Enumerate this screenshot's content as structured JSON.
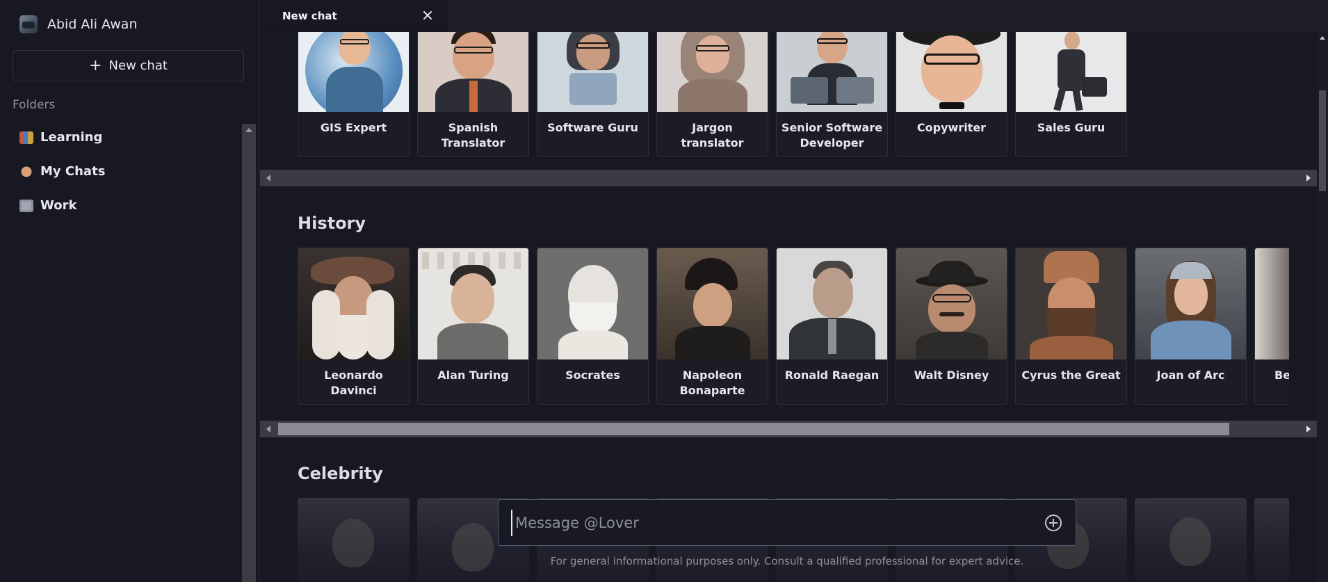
{
  "user": {
    "name": "Abid Ali Awan"
  },
  "sidebar": {
    "new_chat_label": "New chat",
    "folders_label": "Folders",
    "folders": [
      {
        "label": "Learning",
        "icon": "books-icon"
      },
      {
        "label": "My Chats",
        "icon": "pointing-hand-icon"
      },
      {
        "label": "Work",
        "icon": "office-building-icon"
      }
    ]
  },
  "tabs": [
    {
      "label": "New chat"
    }
  ],
  "sections": {
    "top": {
      "cards": [
        {
          "label": "GIS Expert"
        },
        {
          "label": "Spanish Translator"
        },
        {
          "label": "Software Guru"
        },
        {
          "label": "Jargon translator"
        },
        {
          "label": "Senior Software Developer"
        },
        {
          "label": "Copywriter"
        },
        {
          "label": "Sales Guru"
        }
      ]
    },
    "history": {
      "title": "History",
      "cards": [
        {
          "label": "Leonardo Davinci"
        },
        {
          "label": "Alan Turing"
        },
        {
          "label": "Socrates"
        },
        {
          "label": "Napoleon Bonaparte"
        },
        {
          "label": "Ronald Raegan"
        },
        {
          "label": "Walt Disney"
        },
        {
          "label": "Cyrus the Great"
        },
        {
          "label": "Joan of Arc"
        },
        {
          "label": "Be"
        }
      ]
    },
    "celebrity": {
      "title": "Celebrity"
    }
  },
  "composer": {
    "placeholder": "Message @Lover",
    "value": ""
  },
  "disclaimer": "For general informational purposes only. Consult a qualified professional for expert advice.",
  "colors": {
    "background": "#171822",
    "sidebar": "#171822",
    "scrollbar": "#3a3b44",
    "card_border": "#2e2f3b"
  }
}
